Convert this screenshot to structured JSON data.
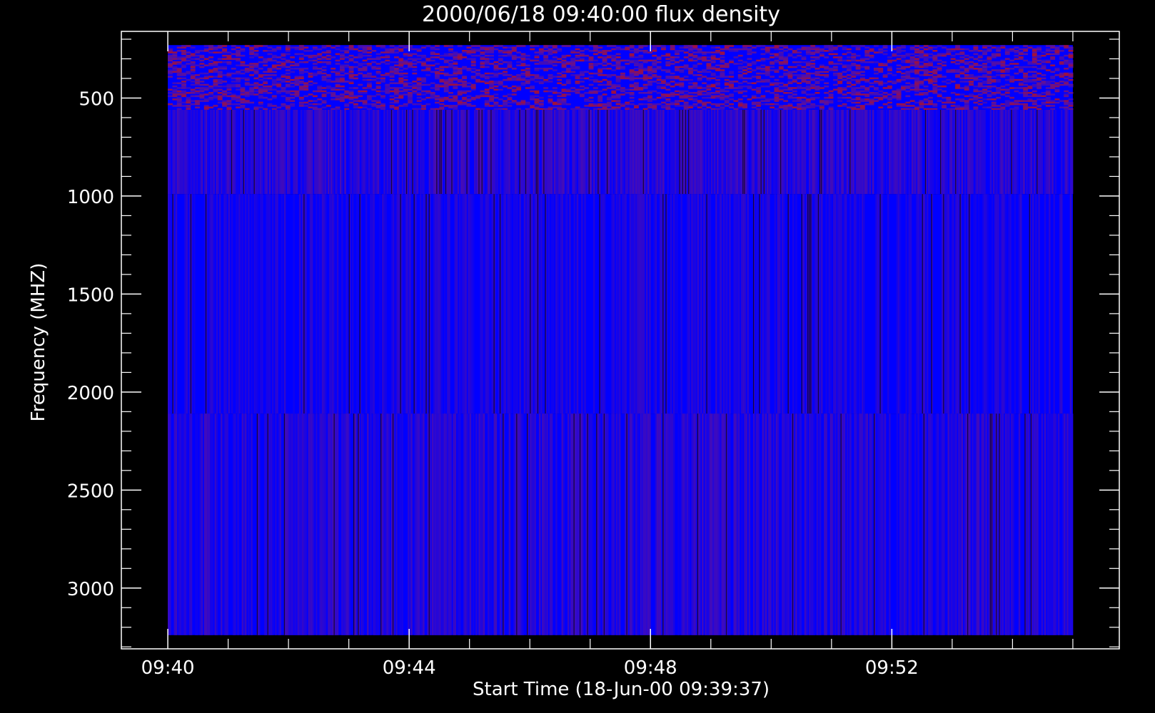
{
  "chart_data": {
    "type": "heatmap",
    "title": "2000/06/18 09:40:00 flux density",
    "xlabel": "Start Time (18-Jun-00 09:39:37)",
    "ylabel": "Frequency (MHZ)",
    "x_tick_labels": [
      "09:40",
      "09:44",
      "09:48",
      "09:52"
    ],
    "y_tick_labels": [
      "500",
      "1000",
      "1500",
      "2000",
      "2500",
      "3000"
    ],
    "y_ticks": [
      500,
      1000,
      1500,
      2000,
      2500,
      3000
    ],
    "y_axis_inverted": true,
    "xlim_minutes_after_0940": [
      -0.77,
      15.77
    ],
    "ylim_mhz": [
      3310,
      160
    ],
    "data_extent": {
      "time_range": [
        "09:40",
        "09:55"
      ],
      "frequency_range_mhz": [
        230,
        3240
      ]
    },
    "bands_mhz": [
      {
        "range": [
          230,
          560
        ],
        "texture": "speckled",
        "level": 0.35
      },
      {
        "range": [
          560,
          990
        ],
        "texture": "striped",
        "level": 0.25
      },
      {
        "range": [
          990,
          2110
        ],
        "texture": "striped",
        "level": 0.1
      },
      {
        "range": [
          2110,
          3240
        ],
        "texture": "striped",
        "level": 0.2
      }
    ],
    "colormap": {
      "low": "#0000ff",
      "mid": "#5a10a0",
      "high": "#c01010",
      "background": "#000000",
      "axes": "#ffffff"
    }
  }
}
